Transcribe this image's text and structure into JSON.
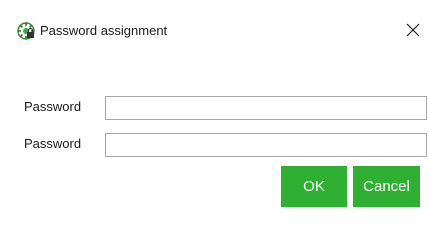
{
  "window": {
    "title": "Password assignment",
    "app_icon": "green-gear-lock-icon",
    "close_icon": "close-icon"
  },
  "form": {
    "password_label": "Password",
    "password_value": "",
    "password_confirm_label": "Password",
    "password_confirm_value": ""
  },
  "buttons": {
    "ok_label": "OK",
    "cancel_label": "Cancel"
  },
  "colors": {
    "button_bg": "#2fb033",
    "button_text": "#ffffff",
    "input_border": "#a8a8a8"
  }
}
